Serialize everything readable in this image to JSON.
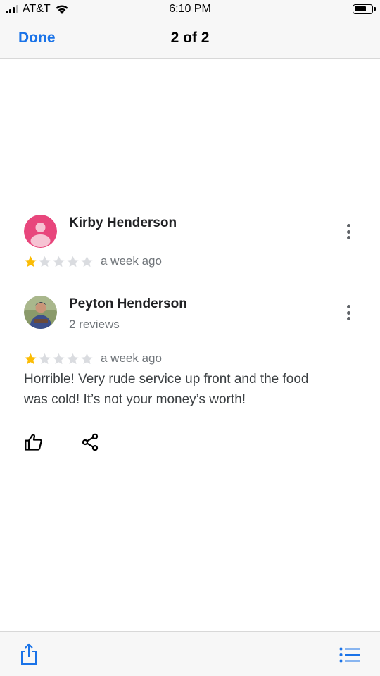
{
  "status_bar": {
    "carrier": "AT&T",
    "time": "6:10 PM"
  },
  "nav": {
    "done_label": "Done",
    "title": "2 of 2"
  },
  "colors": {
    "accent": "#1a73e8",
    "star_filled": "#fbbc04",
    "star_empty": "#dadce0",
    "avatar_pink": "#e8467c"
  },
  "reviews": [
    {
      "name": "Kirby Henderson",
      "rating": 1,
      "max_rating": 5,
      "time_ago": "a week ago"
    },
    {
      "name": "Peyton Henderson",
      "meta": "2 reviews",
      "rating": 1,
      "max_rating": 5,
      "time_ago": "a week ago",
      "text": "Horrible! Very rude service up front and the food was cold! It’s not your money’s worth!"
    }
  ],
  "icons": {
    "like": "thumb-up-icon",
    "share": "share-icon",
    "bottom_share": "ios-share-icon",
    "bottom_list": "list-icon"
  }
}
